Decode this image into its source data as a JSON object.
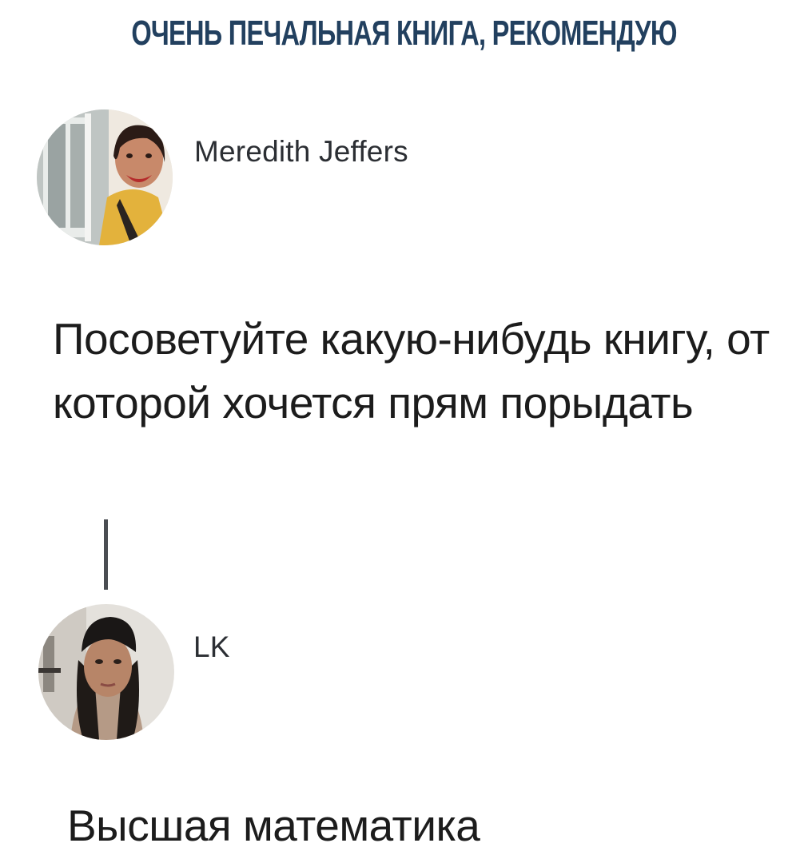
{
  "headline": "ОЧЕНЬ ПЕЧАЛЬНАЯ КНИГА, РЕКОМЕНДУЮ",
  "post": {
    "author": "Meredith Jeffers",
    "avatar_icon": "user-avatar-photo",
    "text": "Посоветуйте какую-нибудь книгу, от которой хочется прям порыдать"
  },
  "reply": {
    "author": "LK",
    "avatar_icon": "user-avatar-photo",
    "text": "Высшая математика"
  },
  "colors": {
    "headline": "#22405f",
    "text": "#1c1c1c",
    "username": "#2b2e33",
    "thread_line": "#4a4d52"
  }
}
